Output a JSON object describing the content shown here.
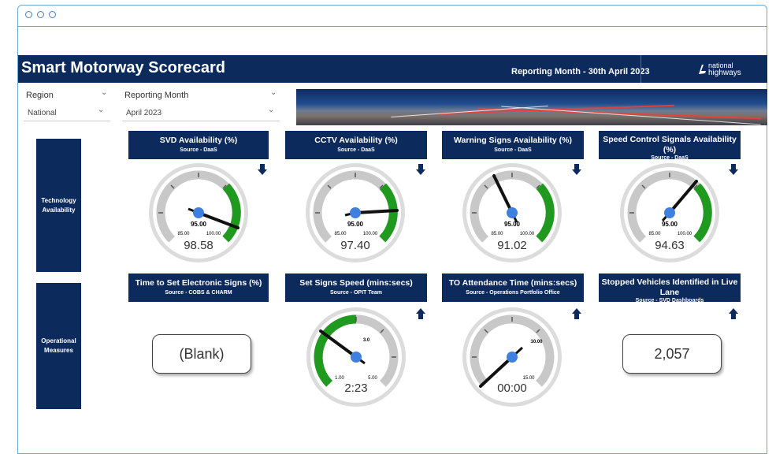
{
  "header": {
    "title": "Smart Motorway Scorecard",
    "reporting_month": "Reporting Month - 30th April 2023",
    "logo_text_1": "national",
    "logo_text_2": "highways"
  },
  "filters": {
    "region": {
      "label": "Region",
      "value": "National"
    },
    "month": {
      "label": "Reporting Month",
      "value": "April 2023"
    }
  },
  "sections": {
    "technology": "Technology Availability",
    "operational": "Operational Measures"
  },
  "colors": {
    "navy": "#0d2a5c",
    "green": "#1f9a1f",
    "gauge_track": "#c8c8c8",
    "needle_dot": "#3f7fe0"
  },
  "cards": [
    {
      "title": "SVD Availability (%)",
      "source": "Source - DaaS",
      "arrow": "down",
      "value": "98.58",
      "target": "95.00",
      "min": "85.00",
      "max": "100.00"
    },
    {
      "title": "CCTV Availability (%)",
      "source": "Source - DaaS",
      "arrow": "down",
      "value": "97.40",
      "target": "95.00",
      "min": "85.00",
      "max": "100.00"
    },
    {
      "title": "Warning Signs Availability (%)",
      "source": "Source - DaaS",
      "arrow": "down",
      "value": "91.02",
      "target": "95.00",
      "min": "85.00",
      "max": "100.00"
    },
    {
      "title": "Speed Control Signals Availability (%)",
      "source": "Source - DaaS",
      "arrow": "down",
      "value": "94.63",
      "target": "95.00",
      "min": "85.00",
      "max": "100.00"
    },
    {
      "title": "Time to Set Electronic Signs (%)",
      "source": "Source - COBS & CHARM",
      "value": "(Blank)"
    },
    {
      "title": "Set Signs Speed (mins:secs)",
      "source": "Source - OPIT Team",
      "arrow": "up",
      "value": "2:23",
      "target": "3.0",
      "min": "1.00",
      "max": "5.00"
    },
    {
      "title": "TO Attendance Time (mins:secs)",
      "source": "Source - Operations Portfolio Office",
      "arrow": "up",
      "value": "00:00",
      "target": "10.00",
      "min": "",
      "max": "15.00"
    },
    {
      "title": "Stopped Vehicles Identified in Live Lane",
      "source": "Source - SVD Dashboards",
      "arrow": "up",
      "value": "2,057"
    }
  ],
  "icons": {
    "dropdown": "chevron-down-icon",
    "trend_down": "arrow-down-icon",
    "trend_up": "arrow-up-icon"
  }
}
